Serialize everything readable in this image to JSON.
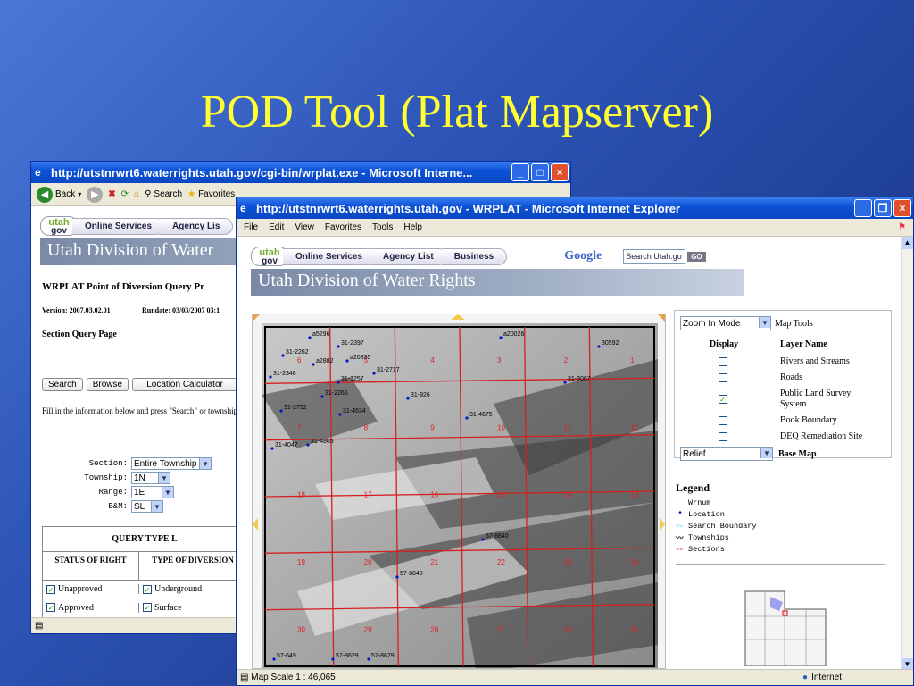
{
  "slide": {
    "title": "POD Tool (Plat Mapserver)"
  },
  "back_window": {
    "title": "http://utstnrwrt6.waterrights.utah.gov/cgi-bin/wrplat.exe - Microsoft Interne...",
    "toolbar": {
      "back": "Back",
      "search": "Search",
      "favorites": "Favorites"
    },
    "nav": {
      "logo_top": "utah",
      "logo_bottom": "gov",
      "tab1": "Online Services",
      "tab2": "Agency Lis"
    },
    "banner": "Utah Division of Water",
    "heading": "WRPLAT Point of Diversion Query Pr",
    "version": "Version: 2007.03.02.01",
    "rundate": "Rundate: 03/03/2007 03:1",
    "section_query": "Section Query Page",
    "buttons": {
      "search": "Search",
      "browse": "Browse",
      "location_calc": "Location Calculator"
    },
    "instructions": "Fill in the information below and press \"Search\" or township.",
    "fields": [
      {
        "label": "Section:",
        "value": "Entire Township"
      },
      {
        "label": "Township:",
        "value": "1N"
      },
      {
        "label": "Range:",
        "value": "1E"
      },
      {
        "label": "B&M:",
        "value": "SL"
      }
    ],
    "query_table": {
      "title": "QUERY TYPE L",
      "col1": "STATUS OF RIGHT",
      "col2": "TYPE OF DIVERSION",
      "rows": [
        [
          "Unapproved",
          "Underground"
        ],
        [
          "Approved",
          "Surface"
        ]
      ]
    }
  },
  "front_window": {
    "title": "http://utstnrwrt6.waterrights.utah.gov - WRPLAT - Microsoft Internet Explorer",
    "menu": [
      "File",
      "Edit",
      "View",
      "Favorites",
      "Tools",
      "Help"
    ],
    "nav": {
      "logo_top": "utah",
      "logo_bottom": "gov",
      "tab1": "Online Services",
      "tab2": "Agency List",
      "tab3": "Business"
    },
    "google": "Google",
    "search_placeholder": "Search Utah.go",
    "go": "GO",
    "banner": "Utah Division of Water Rights",
    "status": "Map Scale 1 : 46,065",
    "status_zone": "Internet",
    "map_mode": "Zoom In Mode",
    "map_tools": "Map Tools",
    "display_header": "Display",
    "layer_header": "Layer Name",
    "layers": [
      {
        "name": "Rivers and Streams",
        "checked": false
      },
      {
        "name": "Roads",
        "checked": false
      },
      {
        "name": "Public Land Survey System",
        "checked": true
      },
      {
        "name": "Book Boundary",
        "checked": false
      },
      {
        "name": "DEQ Remediation Site",
        "checked": false
      }
    ],
    "base_map_value": "Relief",
    "base_map_label": "Base Map",
    "legend_title": "Legend",
    "legend": [
      "Wrnum",
      "Location",
      "Search Boundary",
      "Townships",
      "Sections"
    ],
    "map_labels": [
      "a5296",
      "31-2397",
      "a20026",
      "30592",
      "31-2262",
      "a2882",
      "a20935",
      "31-2348",
      "31-2717",
      "31-3067",
      "31-1257",
      "31-2265",
      "31-926",
      "31-2752",
      "31-4634",
      "31-4675",
      "31-4047",
      "31-4865",
      "57-8840",
      "57-8840",
      "57-8629",
      "57-8629",
      "57-649"
    ],
    "section_numbers": [
      "1",
      "6",
      "5",
      "4",
      "3",
      "2",
      "1",
      "12",
      "7",
      "8",
      "9",
      "10",
      "11",
      "12",
      "13",
      "18",
      "17",
      "16",
      "15",
      "14",
      "13",
      "24",
      "19",
      "20",
      "21",
      "22",
      "23",
      "24",
      "25",
      "30",
      "29",
      "28",
      "27",
      "26",
      "25"
    ],
    "check_mark": "✓",
    "icons": [
      "ie-icon",
      "minimize-icon",
      "restore-icon",
      "close-icon",
      "windows-flag-icon",
      "scroll-up-icon",
      "scroll-down-icon",
      "globe-icon"
    ]
  }
}
